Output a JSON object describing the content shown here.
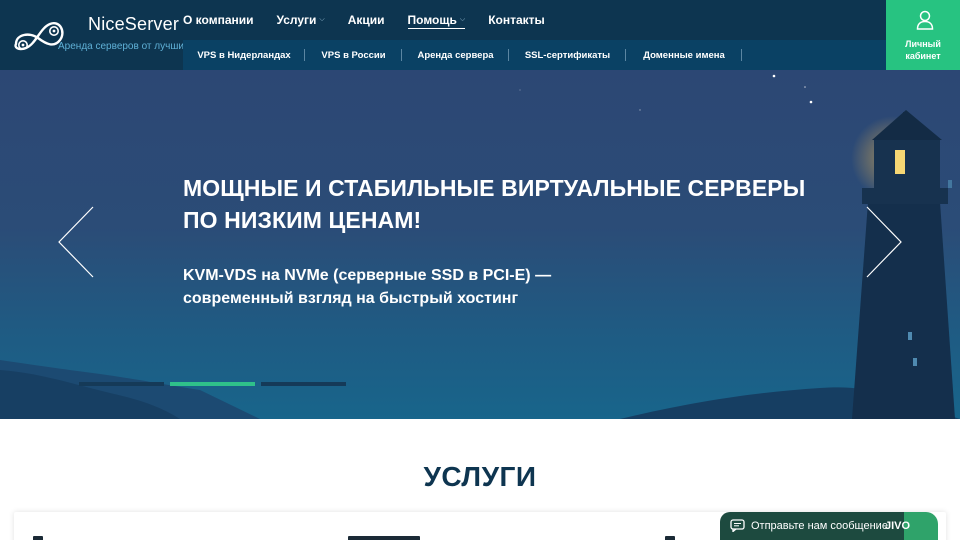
{
  "brand": {
    "name": "NiceServer",
    "tagline": "Аренда серверов от лучших"
  },
  "main_nav": [
    {
      "label": "О компании",
      "has_dropdown": false,
      "active": false
    },
    {
      "label": "Услуги",
      "has_dropdown": true,
      "active": false
    },
    {
      "label": "Акции",
      "has_dropdown": false,
      "active": false
    },
    {
      "label": "Помощь",
      "has_dropdown": true,
      "active": true
    },
    {
      "label": "Контакты",
      "has_dropdown": false,
      "active": false
    }
  ],
  "sub_nav": [
    {
      "label": "VPS в Нидерландах"
    },
    {
      "label": "VPS в России"
    },
    {
      "label": "Аренда сервера"
    },
    {
      "label": "SSL-сертификаты"
    },
    {
      "label": "Доменные имена"
    }
  ],
  "account": {
    "line1": "Личный",
    "line2": "кабинет",
    "icon": "user-icon"
  },
  "hero": {
    "title_line1": "МОЩНЫЕ И СТАБИЛЬНЫЕ ВИРТУАЛЬНЫЕ СЕРВЕРЫ",
    "title_line2": "ПО НИЗКИМ ЦЕНАМ!",
    "subtitle_line1": "KVM-VDS на NVMe (серверные SSD в PCI-E) —",
    "subtitle_line2": "современный взгляд на быстрый хостинг",
    "slides_total": 3,
    "active_slide": 2
  },
  "services": {
    "title": "УСЛУГИ"
  },
  "chat": {
    "label": "Отправьте нам сообщение",
    "brand": "JIVO",
    "icon": "chat-bubble-icon"
  },
  "colors": {
    "header_bg": "#0d3550",
    "subnav_bg": "#0a4164",
    "accent_green": "#27c381",
    "hero_top": "#2c4774",
    "hero_bottom": "#18658b",
    "heading_dark": "#0e3550"
  }
}
